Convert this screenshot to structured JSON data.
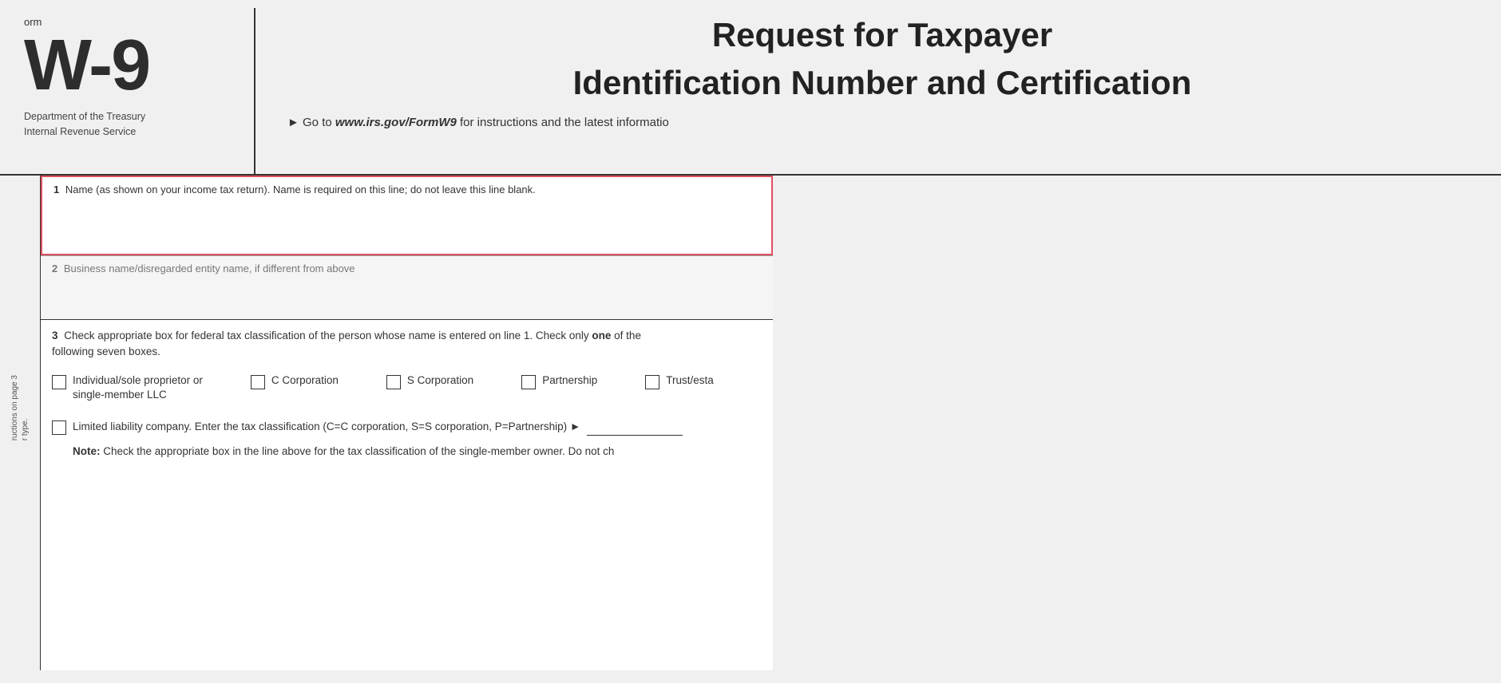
{
  "header": {
    "form_label": "orm",
    "form_number": "W-9",
    "dept_line1": "Department of the Treasury",
    "dept_line2": "Internal Revenue Service",
    "title_line1": "Request for Taxpayer",
    "title_line2": "Identification Number and Certification",
    "url_prefix": "► Go to ",
    "url_text": "www.irs.gov/FormW9",
    "url_suffix": " for instructions and the latest informatio"
  },
  "side_labels": {
    "line1": "r type.",
    "line2": "ructions on page 3"
  },
  "fields": {
    "field1": {
      "number": "1",
      "label": "Name (as shown on your income tax return). Name is required on this line; do not leave this line blank."
    },
    "field2": {
      "number": "2",
      "label": "Business name/disregarded entity name, if different from above"
    },
    "field3": {
      "number": "3",
      "header": "Check appropriate box for federal tax classification of the person whose name is entered on line 1. Check only one of the following seven boxes.",
      "checkboxes": [
        {
          "id": "individual",
          "label_line1": "Individual/sole proprietor or",
          "label_line2": "single-member LLC"
        },
        {
          "id": "c-corp",
          "label_line1": "C Corporation",
          "label_line2": ""
        },
        {
          "id": "s-corp",
          "label_line1": "S Corporation",
          "label_line2": ""
        },
        {
          "id": "partnership",
          "label_line1": "Partnership",
          "label_line2": ""
        },
        {
          "id": "trust",
          "label_line1": "Trust/esta",
          "label_line2": ""
        }
      ],
      "llc_label": "Limited liability company. Enter the tax classification (C=C corporation, S=S corporation, P=Partnership) ►",
      "note_label": "Note:",
      "note_text": "Check the appropriate box in the line above for the tax classification of the single-member owner.  Do not ch"
    }
  }
}
